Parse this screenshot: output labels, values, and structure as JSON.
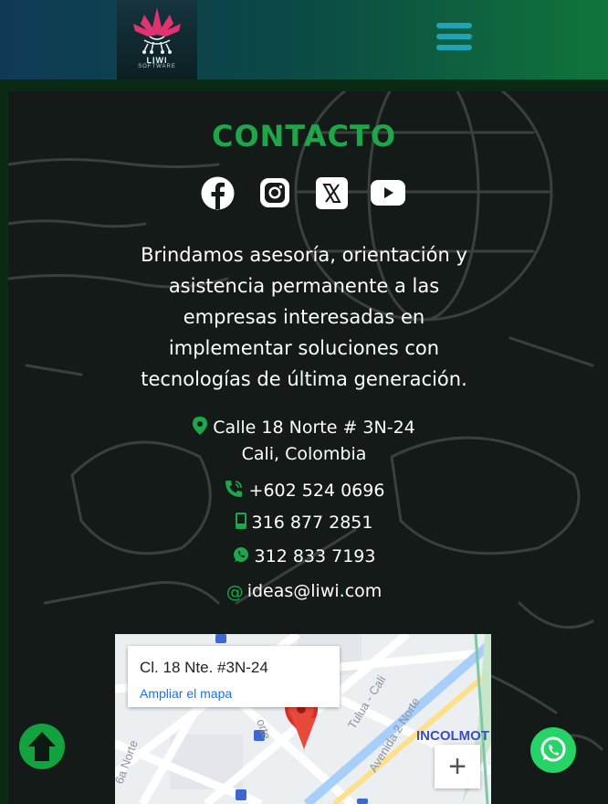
{
  "header": {
    "logo_name": "LIWI",
    "logo_sub": "SOFTWARE",
    "menu_icon": "hamburger-menu-icon"
  },
  "contact": {
    "title": "CONTACTO",
    "social_icons": [
      "facebook-icon",
      "instagram-icon",
      "x-twitter-icon",
      "youtube-icon"
    ],
    "description_lines": [
      "Brindamos asesoría, orientación y",
      "asistencia permanente a las",
      "empresas interesadas en",
      "implementar soluciones con",
      "tecnologías de última generación."
    ],
    "address_line1": "Calle 18 Norte # 3N-24",
    "address_line2": "Cali, Colombia",
    "landline": "+602 524 0696",
    "mobile": "316 877 2851",
    "whatsapp_number": "312 833 7193",
    "email": "ideas@liwi.com"
  },
  "map": {
    "address": "Cl. 18 Nte. #3N-24",
    "expand_link": "Ampliar el mapa",
    "street_labels": [
      "Tulua - Cali",
      "Avenida 2 Norte",
      "6a Norte",
      "orte"
    ],
    "place_label": "INCOLMOT",
    "zoom_in_label": "+"
  },
  "colors": {
    "accent_green": "#1ea64a",
    "menu_blue": "#1fa3b8",
    "whatsapp_green": "#25d366",
    "map_pin": "#d93025"
  }
}
